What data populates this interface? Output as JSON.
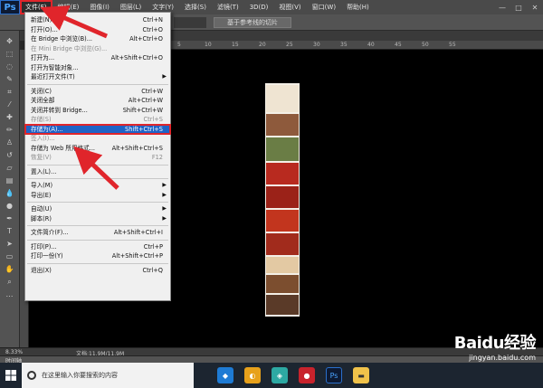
{
  "app": {
    "logo": "Ps",
    "menus": [
      "文件(F)",
      "编辑(E)",
      "图像(I)",
      "图层(L)",
      "文字(Y)",
      "选择(S)",
      "滤镜(T)",
      "3D(D)",
      "视图(V)",
      "窗口(W)",
      "帮助(H)"
    ],
    "window_controls": [
      "—",
      "□",
      "✕"
    ]
  },
  "options_bar": {
    "slice_button": "基于参考线的切片"
  },
  "ruler": {
    "labels": [
      "20",
      "15",
      "10",
      "5",
      "0",
      "5",
      "10",
      "15",
      "20",
      "25",
      "30",
      "35",
      "40",
      "45",
      "50",
      "55"
    ]
  },
  "file_menu": {
    "items": [
      {
        "label": "新建(N)...",
        "shortcut": "Ctrl+N",
        "disabled": false
      },
      {
        "label": "打开(O)...",
        "shortcut": "Ctrl+O",
        "disabled": false
      },
      {
        "label": "在 Bridge 中浏览(B)...",
        "shortcut": "Alt+Ctrl+O",
        "disabled": false
      },
      {
        "label": "在 Mini Bridge 中浏览(G)...",
        "shortcut": "",
        "disabled": true
      },
      {
        "label": "打开为...",
        "shortcut": "Alt+Shift+Ctrl+O",
        "disabled": false
      },
      {
        "label": "打开为智能对象...",
        "shortcut": "",
        "disabled": false
      },
      {
        "label": "最近打开文件(T)",
        "shortcut": "",
        "disabled": false,
        "submenu": true
      },
      {
        "sep": true
      },
      {
        "label": "关闭(C)",
        "shortcut": "Ctrl+W",
        "disabled": false
      },
      {
        "label": "关闭全部",
        "shortcut": "Alt+Ctrl+W",
        "disabled": false
      },
      {
        "label": "关闭并转到 Bridge...",
        "shortcut": "Shift+Ctrl+W",
        "disabled": false
      },
      {
        "label": "存储(S)",
        "shortcut": "Ctrl+S",
        "disabled": true
      },
      {
        "label": "存储为(A)...",
        "shortcut": "Shift+Ctrl+S",
        "disabled": false,
        "selected": true
      },
      {
        "label": "签入(I)...",
        "shortcut": "",
        "disabled": true
      },
      {
        "label": "存储为 Web 所用格式...",
        "shortcut": "Alt+Shift+Ctrl+S",
        "disabled": false
      },
      {
        "label": "恢复(V)",
        "shortcut": "F12",
        "disabled": true
      },
      {
        "sep": true
      },
      {
        "label": "置入(L)...",
        "shortcut": "",
        "disabled": false
      },
      {
        "sep": true
      },
      {
        "label": "导入(M)",
        "shortcut": "",
        "disabled": false,
        "submenu": true
      },
      {
        "label": "导出(E)",
        "shortcut": "",
        "disabled": false,
        "submenu": true
      },
      {
        "sep": true
      },
      {
        "label": "自动(U)",
        "shortcut": "",
        "disabled": false,
        "submenu": true
      },
      {
        "label": "脚本(R)",
        "shortcut": "",
        "disabled": false,
        "submenu": true
      },
      {
        "sep": true
      },
      {
        "label": "文件简介(F)...",
        "shortcut": "Alt+Shift+Ctrl+I",
        "disabled": false
      },
      {
        "sep": true
      },
      {
        "label": "打印(P)...",
        "shortcut": "Ctrl+P",
        "disabled": false
      },
      {
        "label": "打印一份(Y)",
        "shortcut": "Alt+Shift+Ctrl+P",
        "disabled": false
      },
      {
        "sep": true
      },
      {
        "label": "退出(X)",
        "shortcut": "Ctrl+Q",
        "disabled": false
      }
    ]
  },
  "status": {
    "zoom": "8.33%",
    "doc": "文档:11.9M/11.9M"
  },
  "timeline": {
    "label": "时间轴"
  },
  "taskbar": {
    "search_placeholder": "在这里输入你要搜索的内容"
  },
  "watermark": {
    "brand": "Baidu经验",
    "url": "jingyan.baidu.com"
  },
  "colors": {
    "accent": "#1f63c6",
    "highlight": "#e0252b"
  }
}
